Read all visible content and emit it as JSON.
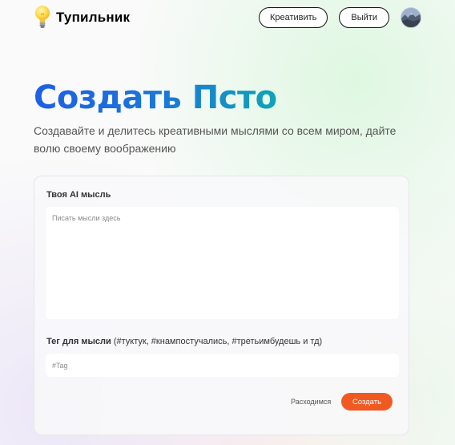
{
  "nav": {
    "brand_name": "Тупильник",
    "logo_icon": "lightbulb-icon",
    "creative_button": "Креативить",
    "logout_button": "Выйти",
    "avatar_icon": "user-avatar"
  },
  "hero": {
    "title": "Создать Псто",
    "subtitle": "Создавайте и делитесь креативными мыслями со всем миром, дайте волю своему воображению"
  },
  "form": {
    "thought_label": "Твоя AI мысль",
    "thought_placeholder": "Писать мысли здесь",
    "tag_label": "Тег для мысли",
    "tag_hint": "(#туктук, #кнампостучались, #третьимбудешь и тд)",
    "tag_placeholder": "#Tag",
    "cancel_label": "Расходимся",
    "submit_label": "Создать"
  },
  "colors": {
    "accent": "#f05a22",
    "title_gradient_start": "#1e5fe6",
    "title_gradient_end": "#0ea5b6"
  }
}
